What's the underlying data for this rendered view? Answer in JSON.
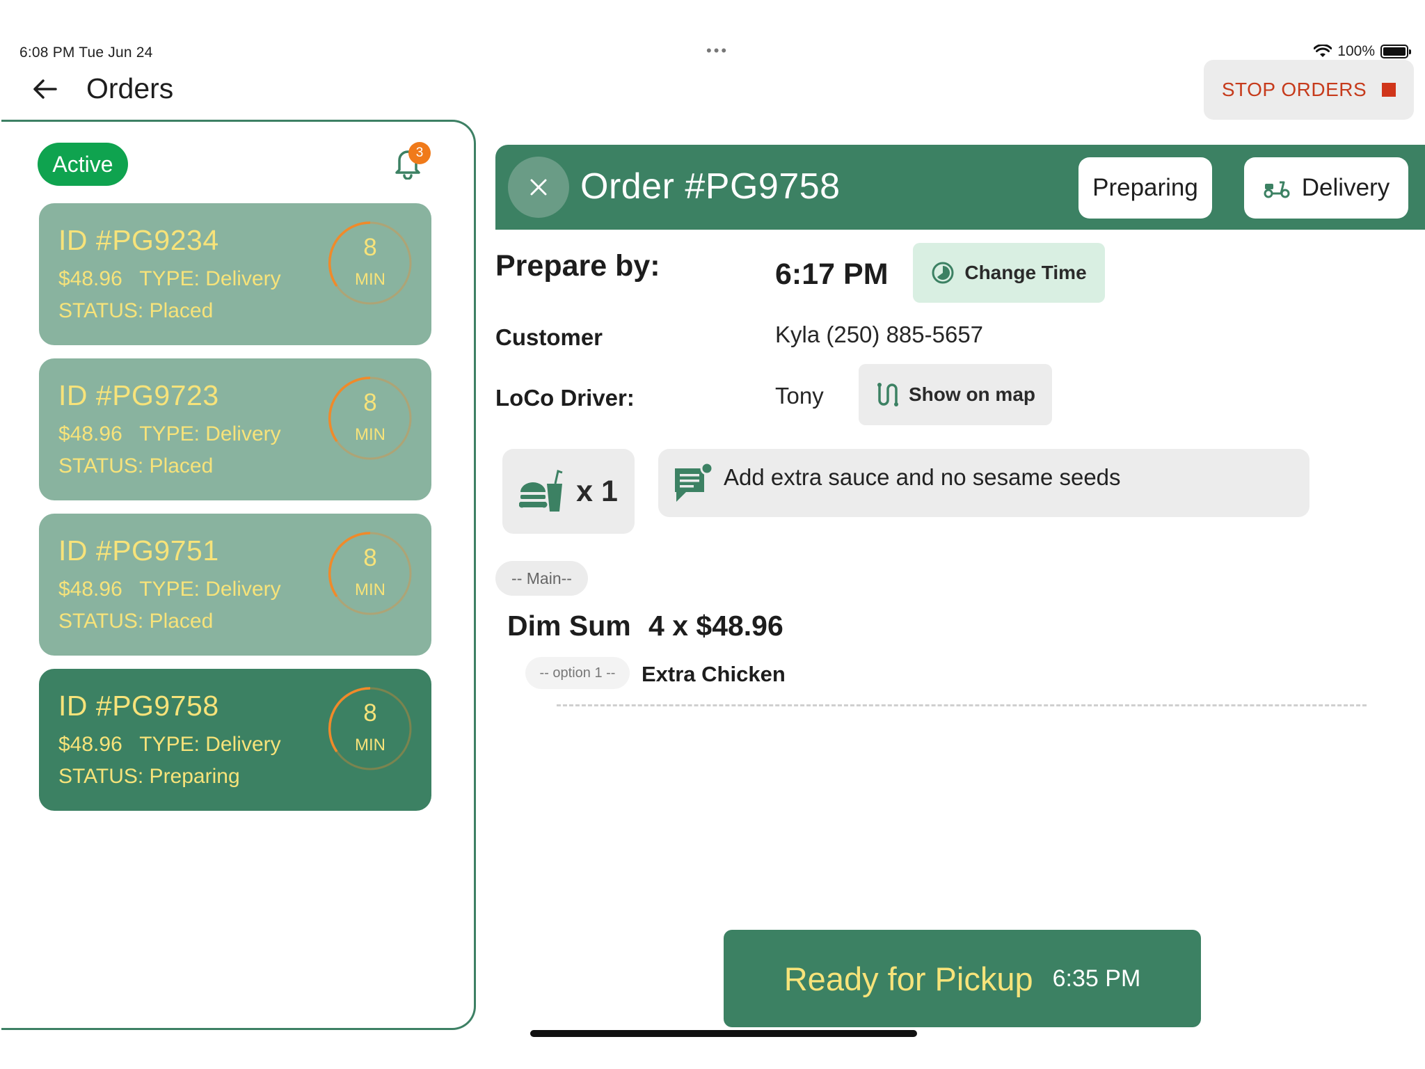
{
  "status_bar": {
    "time": "6:08 PM   Tue Jun 24",
    "dots": "•••",
    "battery": "100%"
  },
  "header": {
    "title": "Orders",
    "stop_label": "STOP ORDERS"
  },
  "sidebar": {
    "filter_label": "Active",
    "notification_count": "3",
    "orders": [
      {
        "id": "ID #PG9234",
        "price": "$48.96",
        "type": "TYPE: Delivery",
        "status": "STATUS: Placed",
        "timer": "8",
        "timer_unit": "MIN",
        "selected": false
      },
      {
        "id": "ID #PG9723",
        "price": "$48.96",
        "type": "TYPE: Delivery",
        "status": "STATUS: Placed",
        "timer": "8",
        "timer_unit": "MIN",
        "selected": false
      },
      {
        "id": "ID #PG9751",
        "price": "$48.96",
        "type": "TYPE: Delivery",
        "status": "STATUS: Placed",
        "timer": "8",
        "timer_unit": "MIN",
        "selected": false
      },
      {
        "id": "ID #PG9758",
        "price": "$48.96",
        "type": "TYPE: Delivery",
        "status": "STATUS: Preparing",
        "timer": "8",
        "timer_unit": "MIN",
        "selected": true
      }
    ]
  },
  "order": {
    "title": "Order #PG9758",
    "status_button": "Preparing",
    "type_button": "Delivery",
    "prepare_by_label": "Prepare by:",
    "prepare_by_time": "6:17 PM",
    "change_time_label": "Change Time",
    "customer_label": "Customer",
    "customer_value": "Kyla (250) 885-5657",
    "driver_label": "LoCo Driver:",
    "driver_value": "Tony",
    "show_map_label": "Show on map",
    "quantity": "x 1",
    "note": "Add extra sauce and no sesame seeds",
    "category": "-- Main--",
    "item_name": "Dim Sum",
    "item_price": "4 x $48.96",
    "option_label": "-- option 1 --",
    "option_value": "Extra Chicken",
    "ready_label": "Ready for Pickup",
    "ready_time": "6:35 PM"
  },
  "colors": {
    "primary_green": "#3c8163",
    "card_green": "#89b39f",
    "accent_yellow": "#f7e37a",
    "stop_red": "#c63b1c",
    "active_green": "#0fa34f",
    "timer_orange": "#f08a2a"
  }
}
